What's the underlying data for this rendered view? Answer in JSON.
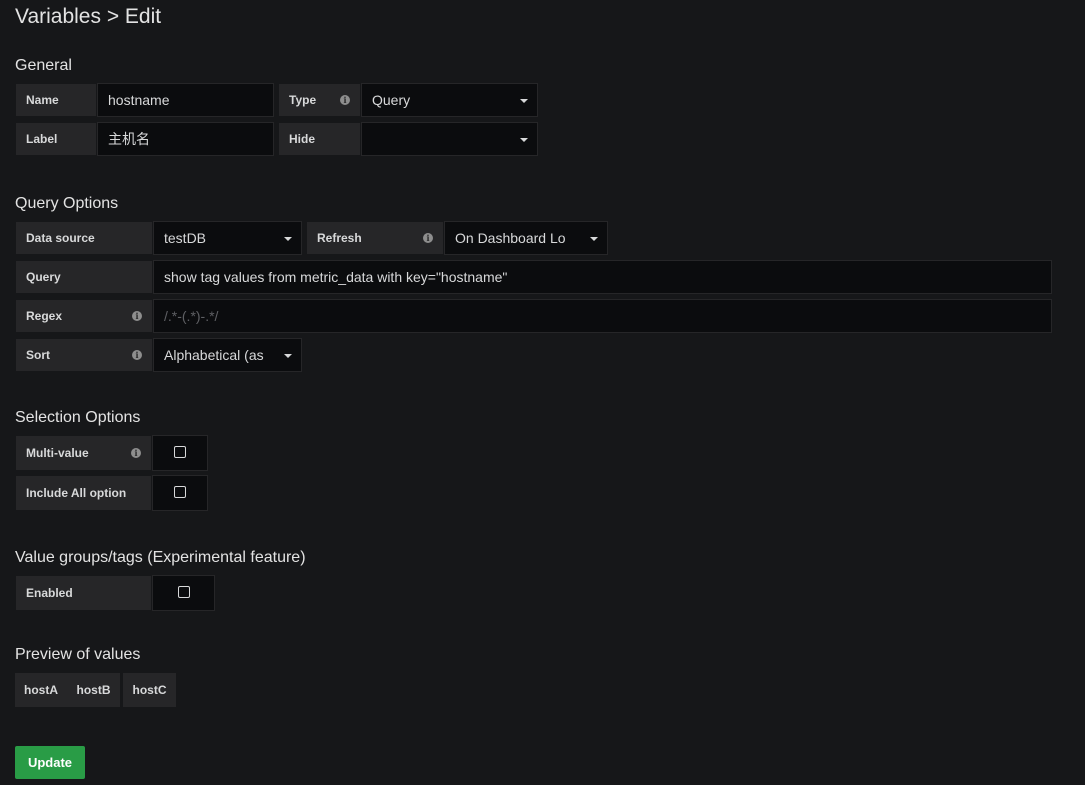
{
  "page": {
    "title": "Variables > Edit"
  },
  "general": {
    "section_title": "General",
    "name_label": "Name",
    "name_value": "hostname",
    "type_label": "Type",
    "type_value": "Query",
    "label_label": "Label",
    "label_value": "主机名",
    "hide_label": "Hide",
    "hide_value": ""
  },
  "query_options": {
    "section_title": "Query Options",
    "datasource_label": "Data source",
    "datasource_value": "testDB",
    "refresh_label": "Refresh",
    "refresh_value": "On Dashboard Lo",
    "query_label": "Query",
    "query_value": "show tag values from metric_data with key=\"hostname\"",
    "regex_label": "Regex",
    "regex_placeholder": "/.*-(.*)-.*/",
    "sort_label": "Sort",
    "sort_value": "Alphabetical (as"
  },
  "selection_options": {
    "section_title": "Selection Options",
    "multi_value_label": "Multi-value",
    "multi_value_checked": false,
    "include_all_label": "Include All option",
    "include_all_checked": false
  },
  "value_groups": {
    "section_title": "Value groups/tags (Experimental feature)",
    "enabled_label": "Enabled",
    "enabled_checked": false
  },
  "preview": {
    "section_title": "Preview of values",
    "values": [
      "hostA",
      "hostB",
      "hostC"
    ]
  },
  "actions": {
    "update_label": "Update"
  },
  "colors": {
    "background": "#161719",
    "label_bg": "#262628",
    "input_bg": "#0b0c0e",
    "text": "#d8d9da",
    "button_green": "#299c46"
  }
}
